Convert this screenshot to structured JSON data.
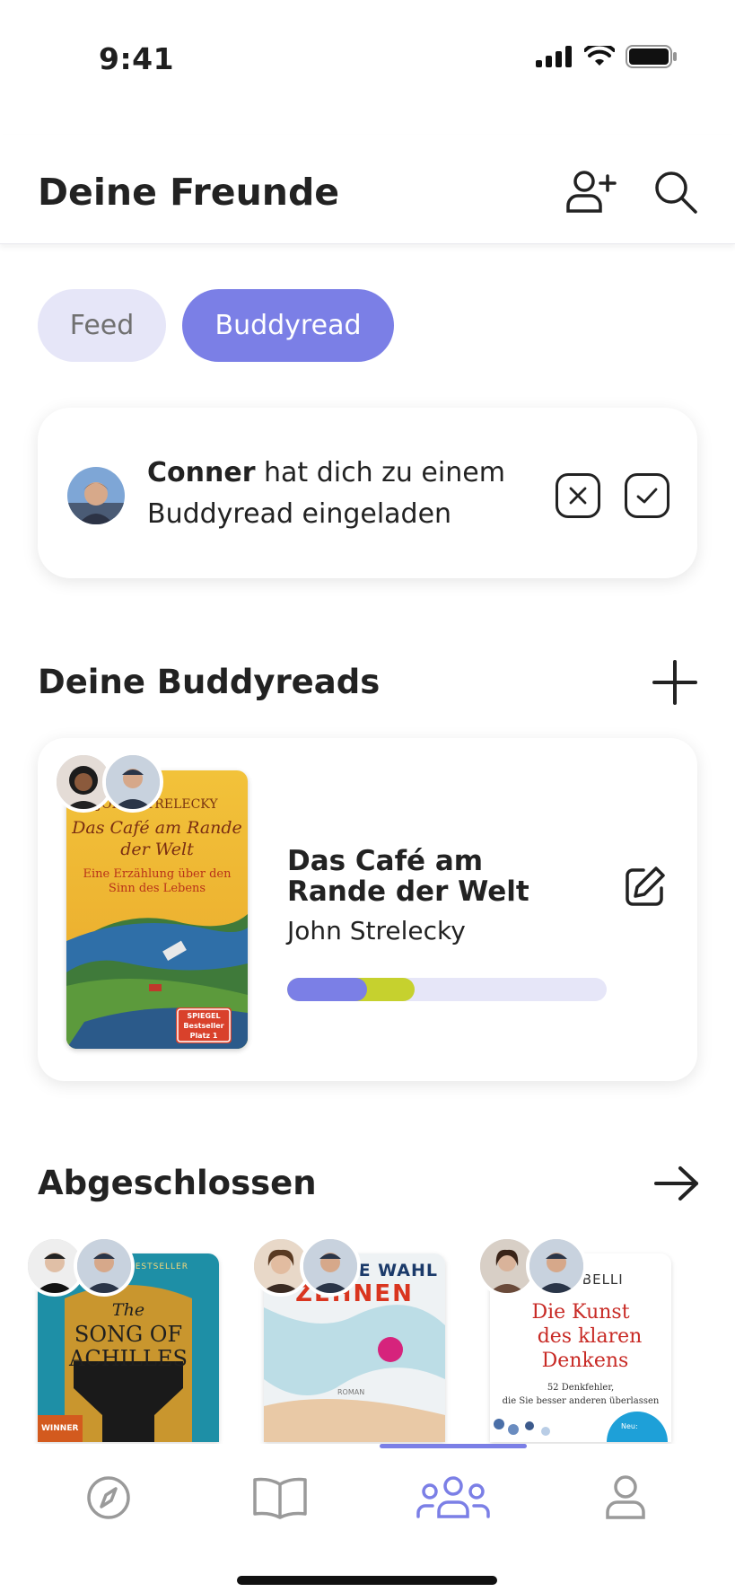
{
  "status_bar": {
    "time": "9:41"
  },
  "header": {
    "title": "Deine Freunde",
    "icons": [
      "add-friend-icon",
      "search-icon"
    ]
  },
  "tabs": [
    {
      "label": "Feed",
      "active": false
    },
    {
      "label": "Buddyread",
      "active": true
    }
  ],
  "invite": {
    "name": "Conner",
    "message": " hat dich zu einem Buddyread eingeladen",
    "icons": [
      "decline-icon",
      "accept-icon"
    ]
  },
  "buddyreads": {
    "title": "Deine Buddyreads",
    "action_icon": "plus-icon",
    "book": {
      "title": "Das Café am Rande der Welt",
      "author": "John Strelecky",
      "cover": {
        "author_line": "JOHN STRELECKY",
        "title_line1": "Das Café am Rande",
        "title_line2": "der Welt",
        "subtitle1": "Eine Erzählung über den",
        "subtitle2": "Sinn des Lebens",
        "badge1": "SPIEGEL",
        "badge2": "Bestseller",
        "badge3": "Platz 1"
      },
      "progress_primary": 0.25,
      "progress_secondary": 0.4
    }
  },
  "completed": {
    "title": "Abgeschlossen",
    "action_icon": "arrow-right-icon",
    "books": [
      {
        "cover_top": "S BESTSELLER",
        "title_a": "The",
        "title_b": "SONG OF",
        "title_c": "ACHILLES",
        "badge": "WINNER"
      },
      {
        "cover_top": "E WAHL",
        "title_a": "ZEHNEN",
        "badge": "ROMAN"
      },
      {
        "cover_top": "OBELLI",
        "title_a": "Die Kunst",
        "title_b": "des klaren",
        "title_c": "Denkens",
        "sub": "52 Denkfehler,",
        "sub2": "die Sie besser anderen überlassen",
        "badge": "Neu:"
      }
    ]
  },
  "nav": {
    "items": [
      "compass-icon",
      "book-icon",
      "friends-icon",
      "profile-icon"
    ],
    "active": "friends-icon"
  },
  "colors": {
    "accent": "#7b7fe6",
    "accent_light": "#e6e6f8",
    "progress_secondary": "#c6d12e"
  }
}
